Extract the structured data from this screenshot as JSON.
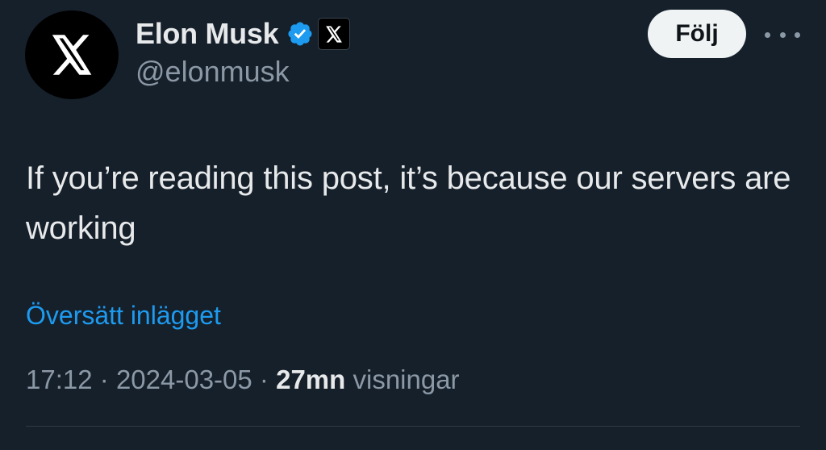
{
  "author": {
    "display_name": "Elon Musk",
    "handle": "@elonmusk",
    "avatar_icon": "x-logo-icon",
    "verified_icon": "verified-badge-icon",
    "affiliate_icon": "x-logo-icon",
    "verified_color": "#1d9bf0"
  },
  "actions": {
    "follow_label": "Följ",
    "more_icon": "more-horizontal-icon"
  },
  "post": {
    "text": "If you’re reading this post, it’s because our servers are working",
    "translate_label": "Översätt inlägget"
  },
  "meta": {
    "time": "17:12",
    "separator": "·",
    "date": "2024-03-05",
    "views_count": "27mn",
    "views_label": "visningar"
  },
  "colors": {
    "background": "#16202b",
    "primary_text": "#e7e9ea",
    "secondary_text": "#8b98a5",
    "link": "#1d9bf0"
  }
}
